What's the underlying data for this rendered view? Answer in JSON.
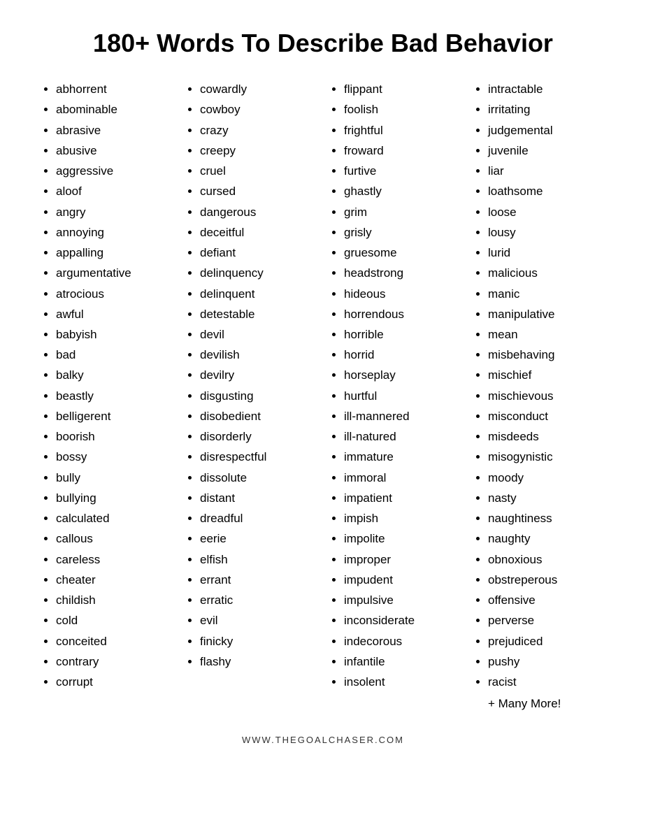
{
  "title": "180+ Words To Describe Bad Behavior",
  "columns": [
    {
      "id": "col1",
      "words": [
        "abhorrent",
        "abominable",
        "abrasive",
        "abusive",
        "aggressive",
        "aloof",
        "angry",
        "annoying",
        "appalling",
        "argumentative",
        "atrocious",
        "awful",
        "babyish",
        "bad",
        "balky",
        "beastly",
        "belligerent",
        "boorish",
        "bossy",
        "bully",
        "bullying",
        "calculated",
        "callous",
        "careless",
        "cheater",
        "childish",
        "cold",
        "conceited",
        "contrary",
        "corrupt"
      ]
    },
    {
      "id": "col2",
      "words": [
        "cowardly",
        "cowboy",
        "crazy",
        "creepy",
        "cruel",
        "cursed",
        "dangerous",
        "deceitful",
        "defiant",
        "delinquency",
        "delinquent",
        "detestable",
        "devil",
        "devilish",
        "devilry",
        "disgusting",
        "disobedient",
        "disorderly",
        "disrespectful",
        "dissolute",
        "distant",
        "dreadful",
        "eerie",
        "elfish",
        "errant",
        "erratic",
        "evil",
        "finicky",
        "flashy"
      ]
    },
    {
      "id": "col3",
      "words": [
        "flippant",
        "foolish",
        "frightful",
        "froward",
        "furtive",
        "ghastly",
        "grim",
        "grisly",
        "gruesome",
        "headstrong",
        "hideous",
        "horrendous",
        "horrible",
        "horrid",
        "horseplay",
        "hurtful",
        "ill-mannered",
        "ill-natured",
        "immature",
        "immoral",
        "impatient",
        "impish",
        "impolite",
        "improper",
        "impudent",
        "impulsive",
        "inconsiderate",
        "indecorous",
        "infantile",
        "insolent"
      ]
    },
    {
      "id": "col4",
      "words": [
        "intractable",
        "irritating",
        "judgemental",
        "juvenile",
        "liar",
        "loathsome",
        "loose",
        "lousy",
        "lurid",
        "malicious",
        "manic",
        "manipulative",
        "mean",
        "misbehaving",
        "mischief",
        "mischievous",
        "misconduct",
        "misdeeds",
        "misogynistic",
        "moody",
        "nasty",
        "naughtiness",
        "naughty",
        "obnoxious",
        "obstreperous",
        "offensive",
        "perverse",
        "prejudiced",
        "pushy",
        "racist"
      ]
    }
  ],
  "more_text": "+ Many More!",
  "footer": "WWW.THEGOALCHASER.COM"
}
